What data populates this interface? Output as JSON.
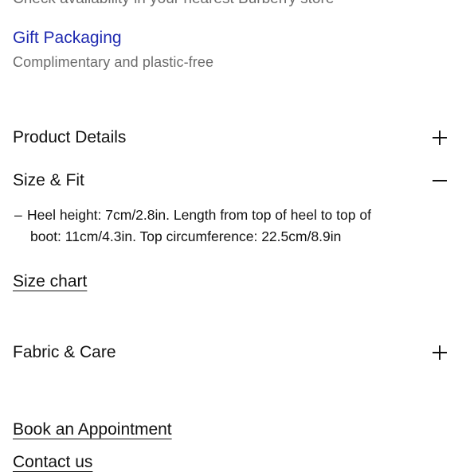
{
  "top_cut_text": "Check availability in your nearest Burberry store",
  "gift": {
    "title": "Gift Packaging",
    "subtitle": "Complimentary and plastic-free"
  },
  "accordion": {
    "product_details": {
      "label": "Product Details",
      "icon": "plus-icon"
    },
    "size_fit": {
      "label": "Size & Fit",
      "icon": "minus-icon",
      "detail_dash": "–",
      "detail_line1": "Heel height: 7cm/2.8in. Length from top of heel to top of",
      "detail_line2": "boot: 11cm/4.3in. Top circumference: 22.5cm/8.9in",
      "size_chart_link": "Size chart"
    },
    "fabric_care": {
      "label": "Fabric & Care",
      "icon": "plus-icon"
    }
  },
  "book_appointment": "Book an Appointment",
  "contact_cut": "Contact us"
}
